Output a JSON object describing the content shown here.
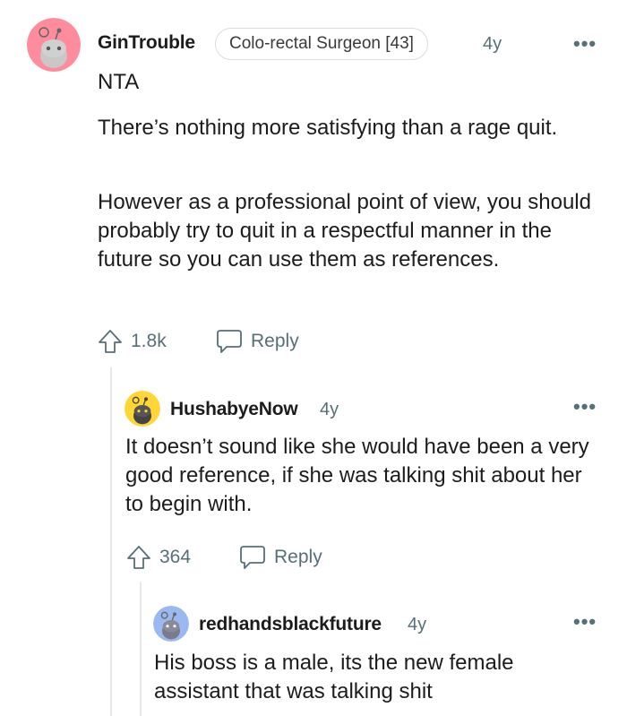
{
  "comments": [
    {
      "username": "GinTrouble",
      "flair": "Colo-rectal Surgeon [43]",
      "age": "4y",
      "more": "•••",
      "paragraphs": [
        "NTA",
        "There’s nothing more satisfying than a rage quit.",
        "However as a professional point of view, you should probably try to quit in a respectful manner in the future so you can use them as references."
      ],
      "upvotes": "1.8k",
      "reply_label": "Reply",
      "avatar_color": "#ff8c9d"
    },
    {
      "username": "HushabyeNow",
      "age": "4y",
      "more": "•••",
      "paragraphs": [
        "It doesn’t sound like she would have been a very good reference, if she was talking shit about her to begin with."
      ],
      "upvotes": "364",
      "reply_label": "Reply",
      "avatar_color": "#ffd635"
    },
    {
      "username": "redhandsblackfuture",
      "age": "4y",
      "more": "•••",
      "paragraphs": [
        "His boss is a male, its the new female assistant that was talking shit"
      ],
      "avatar_color": "#9cb8f0"
    }
  ],
  "icons": {
    "upvote": "upvote-arrow-icon",
    "reply": "speech-bubble-icon",
    "avatar": "snoo-avatar-icon"
  }
}
